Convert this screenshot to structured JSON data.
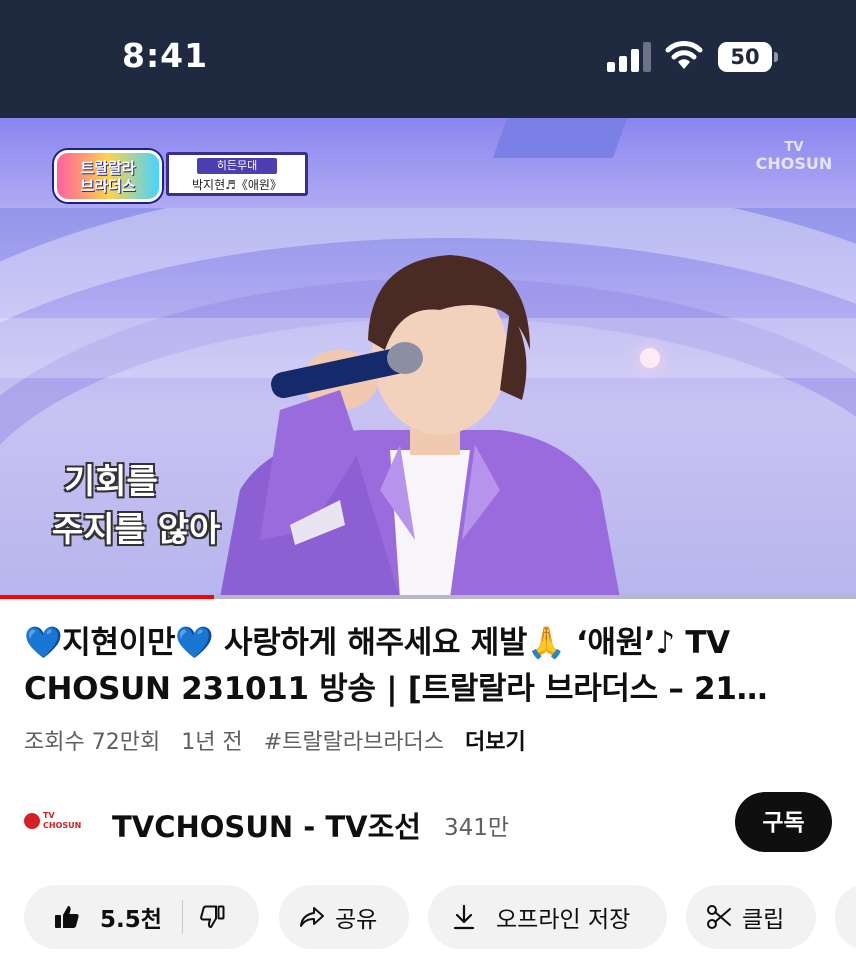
{
  "status_bar": {
    "time": "8:41",
    "battery_level": "50",
    "signal_bars_active": 3,
    "icons": [
      "signal-icon",
      "wifi-icon",
      "battery-icon"
    ]
  },
  "video": {
    "channel_badge": "TV\nCHOSUN",
    "channel_badge_tv": "TV",
    "channel_badge_name": "CHOSUN",
    "show_logo_text": "트랄랄라\n브라더스",
    "caption_top": "히든무대",
    "caption_bottom": "박지현♬《애원》",
    "subtitle_line1": "기회를",
    "subtitle_line2": "주지를 않아",
    "progress_fraction": 0.25
  },
  "title": {
    "text": "💙지현이만💙 사랑하게 해주세요 제발🙏 ‘애원’♪ TV CHOSUN 231011 방송 | [트랄랄라 브라더스 – 21…"
  },
  "meta": {
    "views": "조회수 72만회",
    "age": "1년 전",
    "hashtag": "#트랄랄라브라더스",
    "more": "더보기"
  },
  "channel": {
    "logo_top": "TV",
    "logo_bottom": "CHOSUN",
    "name": "TVCHOSUN - TV조선",
    "subscribers": "341만",
    "subscribe_label": "구독"
  },
  "actions": {
    "like_count": "5.5천",
    "share_label": "공유",
    "save_label": "오프라인 저장",
    "clip_label": "클립"
  },
  "colors": {
    "status_bar_bg": "#1f2a40",
    "progress": "#ff0000",
    "subscribe_bg": "#0f0f0f",
    "pill_bg": "#f2f2f2",
    "brand_red": "#d61f26"
  }
}
